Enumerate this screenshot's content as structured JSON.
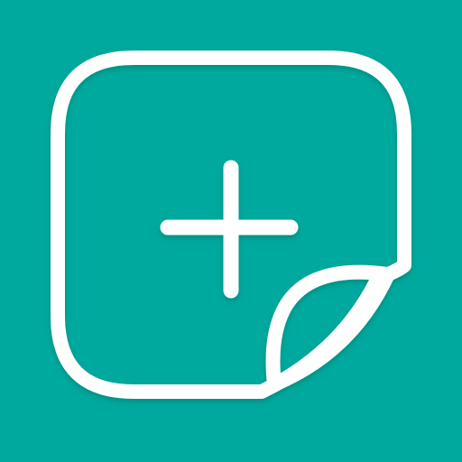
{
  "icon": {
    "name": "add-sticker-icon",
    "background_color": "#00a99d",
    "stroke_color": "#ffffff",
    "symbol": "plus-icon",
    "corner": "peeled-corner"
  }
}
